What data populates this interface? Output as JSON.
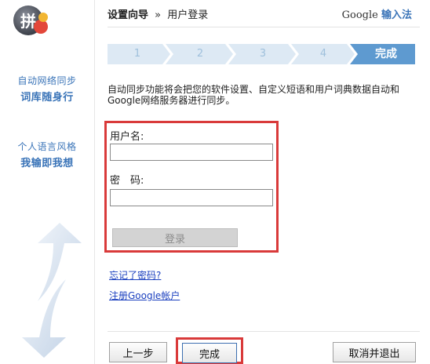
{
  "sidebar": {
    "logo_char": "拼",
    "block1": [
      "自动网络同步",
      "词库随身行"
    ],
    "block2": [
      "个人语言风格",
      "我输即我想"
    ]
  },
  "header": {
    "title": "设置向导",
    "separator": "»",
    "subtitle": "用户登录",
    "brand": "Google",
    "brand_suffix": "输入法"
  },
  "steps": {
    "items": [
      "1",
      "2",
      "3",
      "4",
      "完成"
    ],
    "active_index": 4
  },
  "description": "自动同步功能将会把您的软件设置、自定义短语和用户词典数据自动和Google网络服务器进行同步。",
  "login": {
    "username_label": "用户名:",
    "username_value": "",
    "password_label": "密　码:",
    "password_value": "",
    "submit_label": "登录"
  },
  "links": {
    "forgot": "忘记了密码?",
    "register": "注册Google帐户"
  },
  "footer": {
    "prev_label": "上一步",
    "done_label": "完成",
    "cancel_label": "取消并退出"
  },
  "colors": {
    "accent_blue": "#3a74b8",
    "step_inactive": "#dde9f4",
    "step_active": "#5e9ad0",
    "highlight_red": "#d93a3a"
  }
}
